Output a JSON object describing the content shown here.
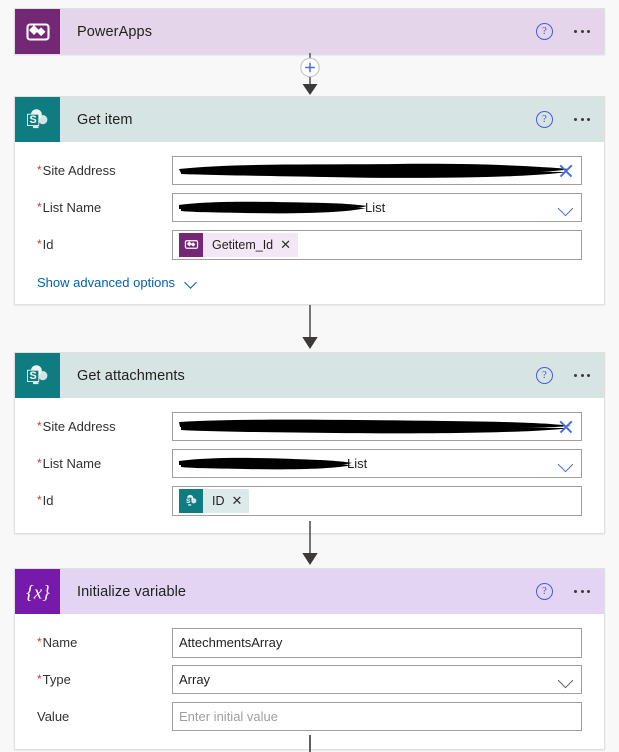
{
  "theme": {
    "page_bg": "#f8f8f8",
    "powerapps_purple": "#742774",
    "powerapps_header": "#e5d5ea",
    "sharepoint_teal": "#0f7c82",
    "sharepoint_header": "#d6e5e3",
    "variable_violet": "#7719aa",
    "variable_header": "#e4d4f4",
    "link_blue": "#0062ad",
    "required_red": "#d13438",
    "accent_blue": "#4a6fd4"
  },
  "cards": [
    {
      "id": "powerapps",
      "title": "PowerApps",
      "icon": "powerapps-icon",
      "help_icon": "help-icon",
      "menu_icon": "ellipsis-icon"
    },
    {
      "id": "get-item",
      "title": "Get item",
      "icon": "sharepoint-icon",
      "help_icon": "help-icon",
      "menu_icon": "ellipsis-icon",
      "fields": [
        {
          "label": "Site Address",
          "required": true,
          "value": "",
          "redacted": true,
          "affix": "clear-icon"
        },
        {
          "label": "List Name",
          "required": true,
          "value": "List",
          "redacted": true,
          "affix": "chevron-down-icon"
        },
        {
          "label": "Id",
          "required": true,
          "token": {
            "text": "Getitem_Id",
            "source": "powerapps"
          }
        }
      ],
      "advanced_label": "Show advanced options"
    },
    {
      "id": "get-attachments",
      "title": "Get attachments",
      "icon": "sharepoint-icon",
      "help_icon": "help-icon",
      "menu_icon": "ellipsis-icon",
      "fields": [
        {
          "label": "Site Address",
          "required": true,
          "value": "",
          "redacted": true,
          "affix": "clear-icon"
        },
        {
          "label": "List Name",
          "required": true,
          "value": "List",
          "redacted": true,
          "affix": "chevron-down-icon"
        },
        {
          "label": "Id",
          "required": true,
          "token": {
            "text": "ID",
            "source": "sharepoint"
          }
        }
      ]
    },
    {
      "id": "initialize-variable",
      "title": "Initialize variable",
      "icon": "variable-icon",
      "help_icon": "help-icon",
      "menu_icon": "ellipsis-icon",
      "fields": [
        {
          "label": "Name",
          "required": true,
          "value": "AttechmentsArray"
        },
        {
          "label": "Type",
          "required": true,
          "value": "Array",
          "affix": "chevron-down-icon"
        },
        {
          "label": "Value",
          "required": false,
          "value": "",
          "placeholder": "Enter initial value"
        }
      ]
    }
  ],
  "connectors": [
    {
      "id": "add-step-connector",
      "icon": "plus-circle-icon",
      "arrow": "arrow-down-icon"
    },
    {
      "id": "flow-arrow-1",
      "arrow": "arrow-down-icon"
    },
    {
      "id": "flow-arrow-2",
      "arrow": "arrow-down-icon"
    },
    {
      "id": "flow-line-bottom",
      "arrow": "line-stub"
    }
  ]
}
